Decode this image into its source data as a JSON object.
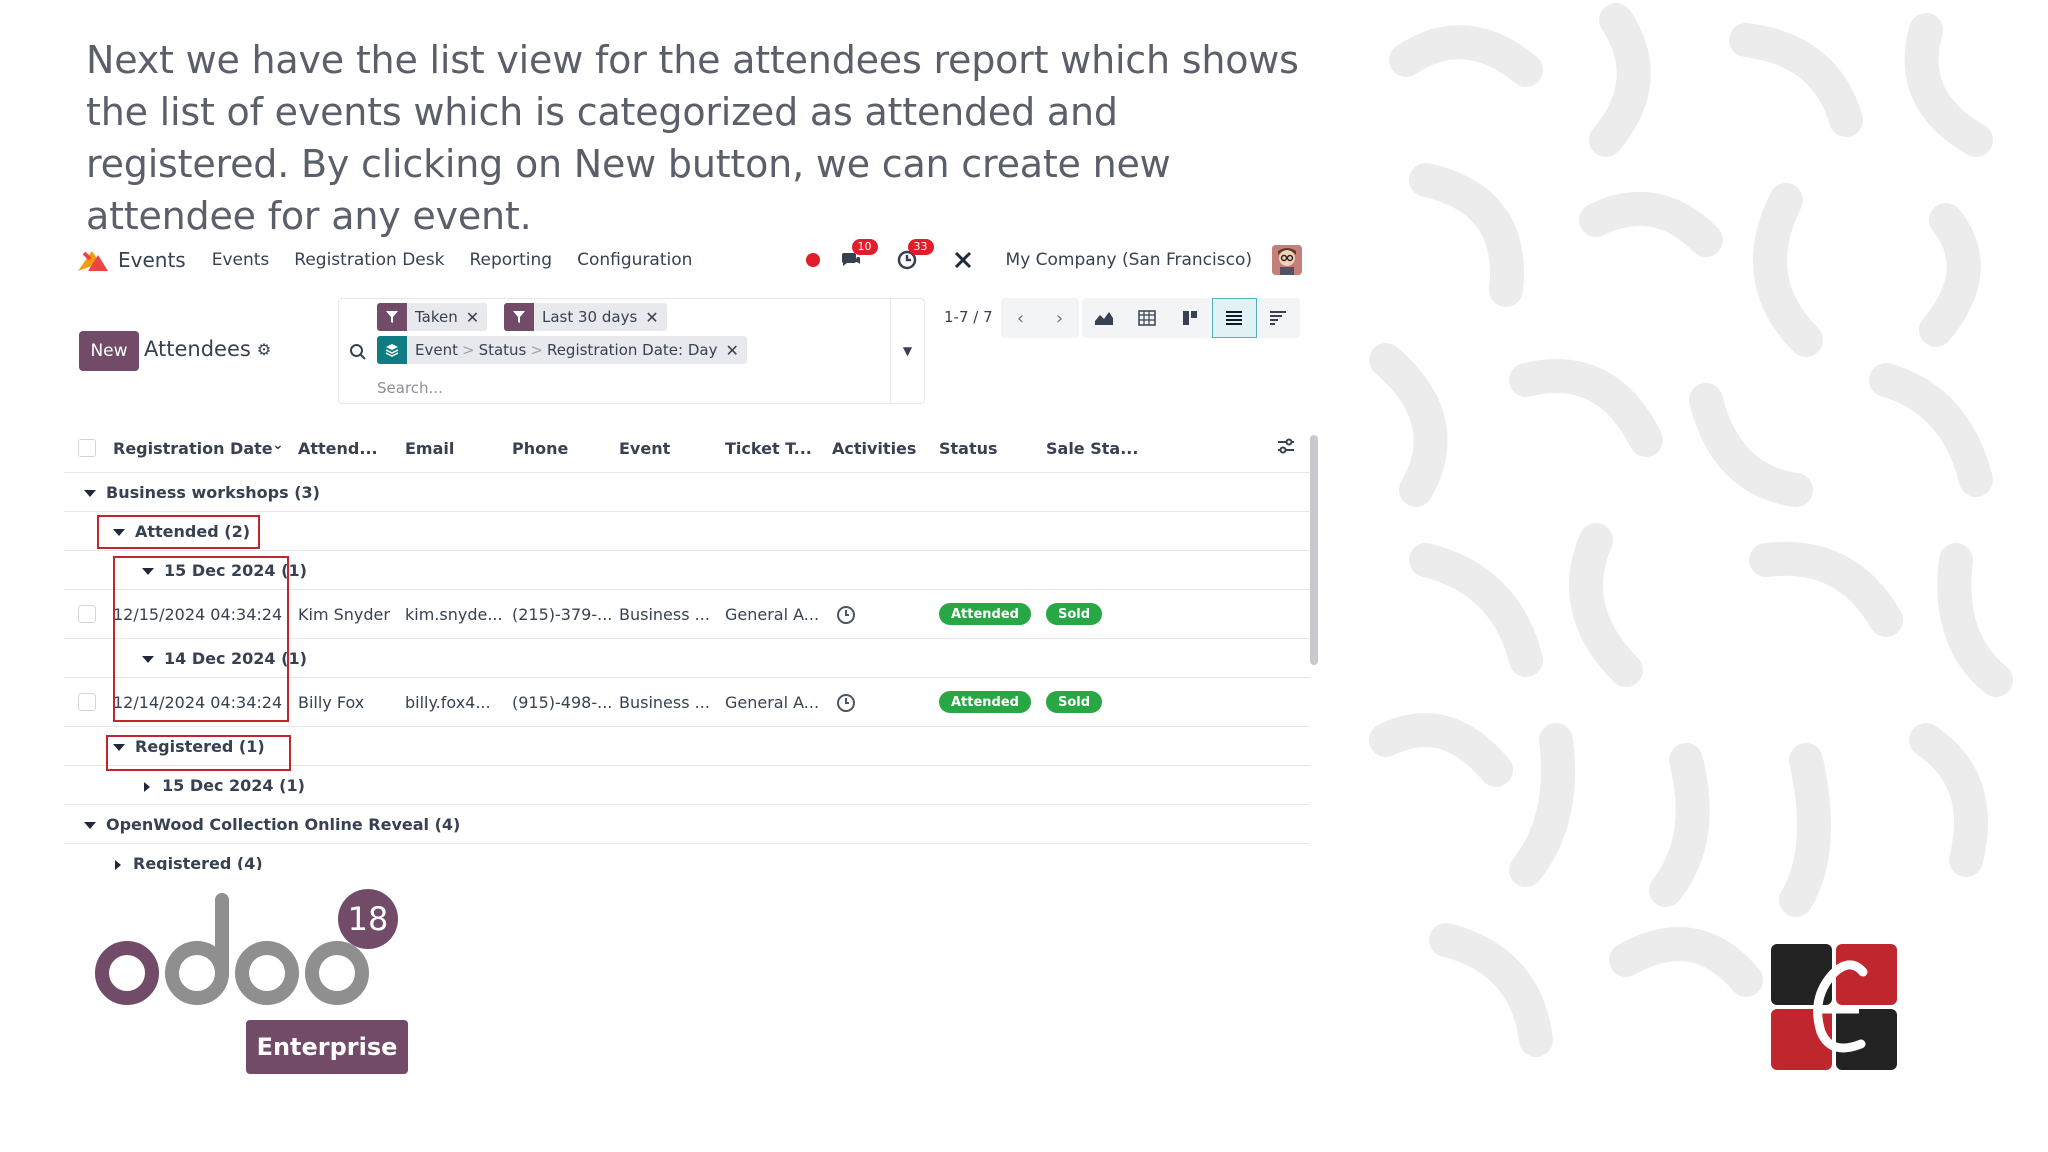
{
  "caption": "Next we have the list view for the attendees report which shows the list of events which is categorized as attended and registered. By clicking on New button, we can create new attendee for any event.",
  "navbar": {
    "app_name": "Events",
    "menu": [
      "Events",
      "Registration Desk",
      "Reporting",
      "Configuration"
    ],
    "messages_count": "10",
    "activities_count": "33",
    "company": "My Company (San Francisco)"
  },
  "control": {
    "new_label": "New",
    "title": "Attendees",
    "facets": {
      "filter1": "Taken",
      "filter2": "Last 30 days",
      "group_parts": [
        "Event",
        "Status",
        "Registration Date: Day"
      ],
      "group_sep": ">"
    },
    "search_placeholder": "Search...",
    "pager": "1-7 / 7"
  },
  "list": {
    "columns": [
      "Registration Date",
      "Attend...",
      "Email",
      "Phone",
      "Event",
      "Ticket T...",
      "Activities",
      "Status",
      "Sale Sta..."
    ],
    "groups": {
      "g1": "Business workshops (3)",
      "g1_attended": "Attended (2)",
      "g1_att_day1": "15 Dec 2024 (1)",
      "g1_att_day2": "14 Dec 2024 (1)",
      "g1_registered": "Registered (1)",
      "g1_reg_day1": "15 Dec 2024 (1)",
      "g2": "OpenWood Collection Online Reveal (4)",
      "g2_registered": "Registered (4)"
    },
    "rows": [
      {
        "date": "12/15/2024 04:34:24",
        "attendee": "Kim Snyder",
        "email": "kim.snyde...",
        "phone": "(215)-379-...",
        "event": "Business ...",
        "ticket": "General A...",
        "status": "Attended",
        "sale": "Sold"
      },
      {
        "date": "12/14/2024 04:34:24",
        "attendee": "Billy Fox",
        "email": "billy.fox4...",
        "phone": "(915)-498-...",
        "event": "Business ...",
        "ticket": "General A...",
        "status": "Attended",
        "sale": "Sold"
      }
    ]
  },
  "logo": {
    "version": "18",
    "edition": "Enterprise"
  },
  "colors": {
    "brand_purple": "#714b67",
    "success_green": "#28a745",
    "highlight_red": "#c0262d",
    "teal": "#0f7b82"
  }
}
